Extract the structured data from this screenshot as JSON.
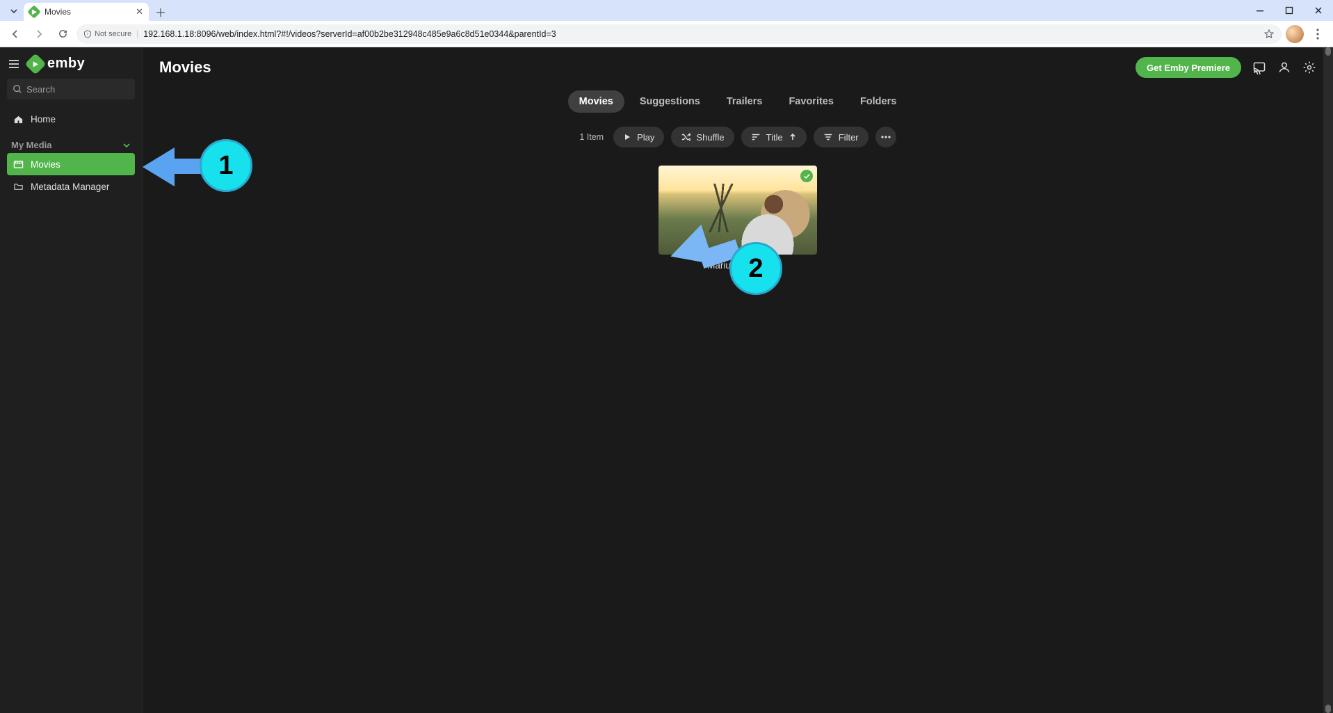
{
  "browser": {
    "tab_title": "Movies",
    "security_label": "Not secure",
    "url": "192.168.1.18:8096/web/index.html?#!/videos?serverId=af00b2be312948c485e9a6c8d51e0344&parentId=3"
  },
  "sidebar": {
    "brand": "emby",
    "search_placeholder": "Search",
    "home_label": "Home",
    "section_label": "My Media",
    "items": [
      {
        "label": "Movies",
        "icon": "movie-icon",
        "active": true
      },
      {
        "label": "Metadata Manager",
        "icon": "folder-icon",
        "active": false
      }
    ]
  },
  "header": {
    "title": "Movies",
    "premiere_button": "Get Emby Premiere"
  },
  "tabs": [
    {
      "label": "Movies",
      "active": true
    },
    {
      "label": "Suggestions",
      "active": false
    },
    {
      "label": "Trailers",
      "active": false
    },
    {
      "label": "Favorites",
      "active": false
    },
    {
      "label": "Folders",
      "active": false
    }
  ],
  "controls": {
    "item_count": "1 Item",
    "play": "Play",
    "shuffle": "Shuffle",
    "sort_field": "Title",
    "filter": "Filter"
  },
  "gallery": {
    "items": [
      {
        "title": "Marius hosting",
        "watched": true
      }
    ]
  },
  "annotations": {
    "one": "1",
    "two": "2"
  },
  "colors": {
    "accent": "#52b54b",
    "annotation": "#16e1ec",
    "arrow": "#5aa3f1"
  }
}
